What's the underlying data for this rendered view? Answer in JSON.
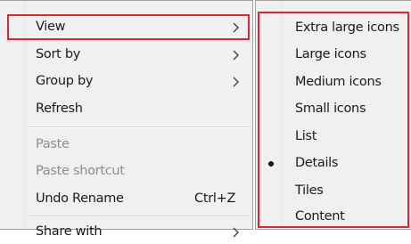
{
  "context_menu": {
    "items": [
      {
        "label": "View",
        "submenu": true
      },
      {
        "label": "Sort by",
        "submenu": true
      },
      {
        "label": "Group by",
        "submenu": true
      },
      {
        "label": "Refresh"
      },
      {
        "label": "Paste",
        "disabled": true
      },
      {
        "label": "Paste shortcut",
        "disabled": true
      },
      {
        "label": "Undo Rename",
        "shortcut": "Ctrl+Z"
      },
      {
        "label": "Share with",
        "submenu": true
      }
    ]
  },
  "view_submenu": {
    "items": [
      {
        "label": "Extra large icons"
      },
      {
        "label": "Large icons"
      },
      {
        "label": "Medium icons"
      },
      {
        "label": "Small icons"
      },
      {
        "label": "List"
      },
      {
        "label": "Details",
        "selected": true
      },
      {
        "label": "Tiles"
      },
      {
        "label": "Content"
      }
    ]
  },
  "colors": {
    "menu_background": "#f0f0f0",
    "highlight_border": "#e0262e",
    "disabled_text": "#8d8d8d",
    "text": "#1a1a1a"
  }
}
